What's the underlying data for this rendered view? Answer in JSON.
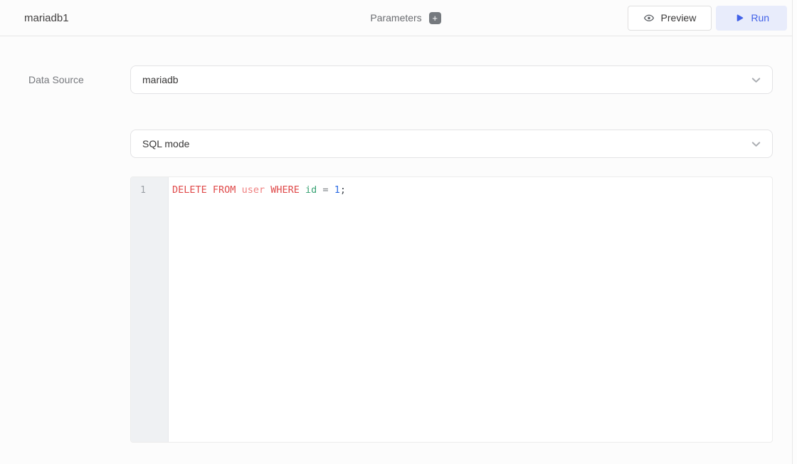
{
  "header": {
    "title": "mariadb1",
    "parameters_label": "Parameters",
    "add_parameter_icon": "+",
    "preview_label": "Preview",
    "run_label": "Run"
  },
  "form": {
    "data_source_label": "Data Source",
    "data_source_value": "mariadb",
    "mode_value": "SQL mode"
  },
  "editor": {
    "line_number": "1",
    "code_text": "DELETE FROM user WHERE id = 1;",
    "tokens": [
      {
        "text": "DELETE",
        "type": "keyword"
      },
      {
        "text": " ",
        "type": "plain"
      },
      {
        "text": "FROM",
        "type": "keyword"
      },
      {
        "text": " ",
        "type": "plain"
      },
      {
        "text": "user",
        "type": "table"
      },
      {
        "text": " ",
        "type": "plain"
      },
      {
        "text": "WHERE",
        "type": "keyword"
      },
      {
        "text": " ",
        "type": "plain"
      },
      {
        "text": "id",
        "type": "column"
      },
      {
        "text": " ",
        "type": "plain"
      },
      {
        "text": "=",
        "type": "operator"
      },
      {
        "text": " ",
        "type": "plain"
      },
      {
        "text": "1",
        "type": "number"
      },
      {
        "text": ";",
        "type": "punctuation"
      }
    ],
    "token_colors": {
      "keyword": "#e04b4b",
      "table": "#f08080",
      "column": "#38a273",
      "operator": "#7a7f84",
      "number": "#2e6de4",
      "punctuation": "#40474e"
    }
  },
  "colors": {
    "run_accent": "#4262e8",
    "run_background": "#e8ecfb",
    "gutter_background": "#eff1f3",
    "header_border": "#e6e6e6"
  }
}
